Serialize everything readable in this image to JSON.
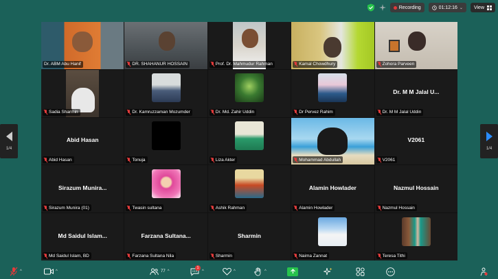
{
  "topbar": {
    "recording_label": "Recording",
    "timer": "01:12:16",
    "view_label": "View"
  },
  "pagination": {
    "left": "1/4",
    "right": "1/4"
  },
  "participants": [
    {
      "name": "Dr. ABM Abu Hanif",
      "muted": false,
      "video": true,
      "active": true
    },
    {
      "name": "DR. SHAHANUR HOSSAIN",
      "muted": true,
      "video": true
    },
    {
      "name": "Prof. Dr. Mahmudur Rahman",
      "muted": true,
      "video": true
    },
    {
      "name": "Kamal Chowdhury",
      "muted": true,
      "video": true
    },
    {
      "name": "Zohora Parveen",
      "muted": true,
      "video": true
    },
    {
      "name": "Sadia Sharmin",
      "muted": true,
      "video": true
    },
    {
      "name": "Dr. Kamruzzaman Mozumder",
      "muted": true,
      "avatar": true
    },
    {
      "name": "Dr. Md. Zahir Uddin",
      "muted": true,
      "avatar": true
    },
    {
      "name": "Dr Pervez Rahim",
      "muted": true,
      "avatar": true
    },
    {
      "name": "Dr. M M Jalal Uddin",
      "muted": true,
      "display_name": "Dr. M M Jalal U..."
    },
    {
      "name": "Abid Hasan",
      "muted": true,
      "display_name": "Abid Hasan"
    },
    {
      "name": "Tonuja",
      "muted": true,
      "avatar": true
    },
    {
      "name": "Liza Akter",
      "muted": true,
      "avatar": true
    },
    {
      "name": "Mohammad Abdullah",
      "muted": true,
      "video": true
    },
    {
      "name": "V2061",
      "muted": true,
      "display_name": "V2061"
    },
    {
      "name": "Sirazum Munira (01)",
      "muted": true,
      "display_name": "Sirazum Munira..."
    },
    {
      "name": "Twasin sultana",
      "muted": true,
      "avatar": true
    },
    {
      "name": "Ashik Rahman",
      "muted": true,
      "avatar": true
    },
    {
      "name": "Alamin Howlader",
      "muted": true,
      "display_name": "Alamin Howlader"
    },
    {
      "name": "Nazmul Hossain",
      "muted": true,
      "display_name": "Nazmul Hossain"
    },
    {
      "name": "Md Saidul Islam, BD",
      "muted": true,
      "display_name": "Md Saidul Islam..."
    },
    {
      "name": "Farzana Sultana Nila",
      "muted": true,
      "display_name": "Farzana Sultana..."
    },
    {
      "name": "Sharmin",
      "muted": true,
      "display_name": "Sharmin"
    },
    {
      "name": "Naima Zannat",
      "muted": true,
      "avatar": true
    },
    {
      "name": "Teresa Tithi",
      "muted": true,
      "avatar": true
    }
  ],
  "toolbar": {
    "participants_count": "77",
    "chat_badge": "1"
  },
  "colors": {
    "background": "#1b6159",
    "active_speaker": "#3dd64e",
    "muted": "#e23b3b",
    "share": "#27c24c"
  }
}
